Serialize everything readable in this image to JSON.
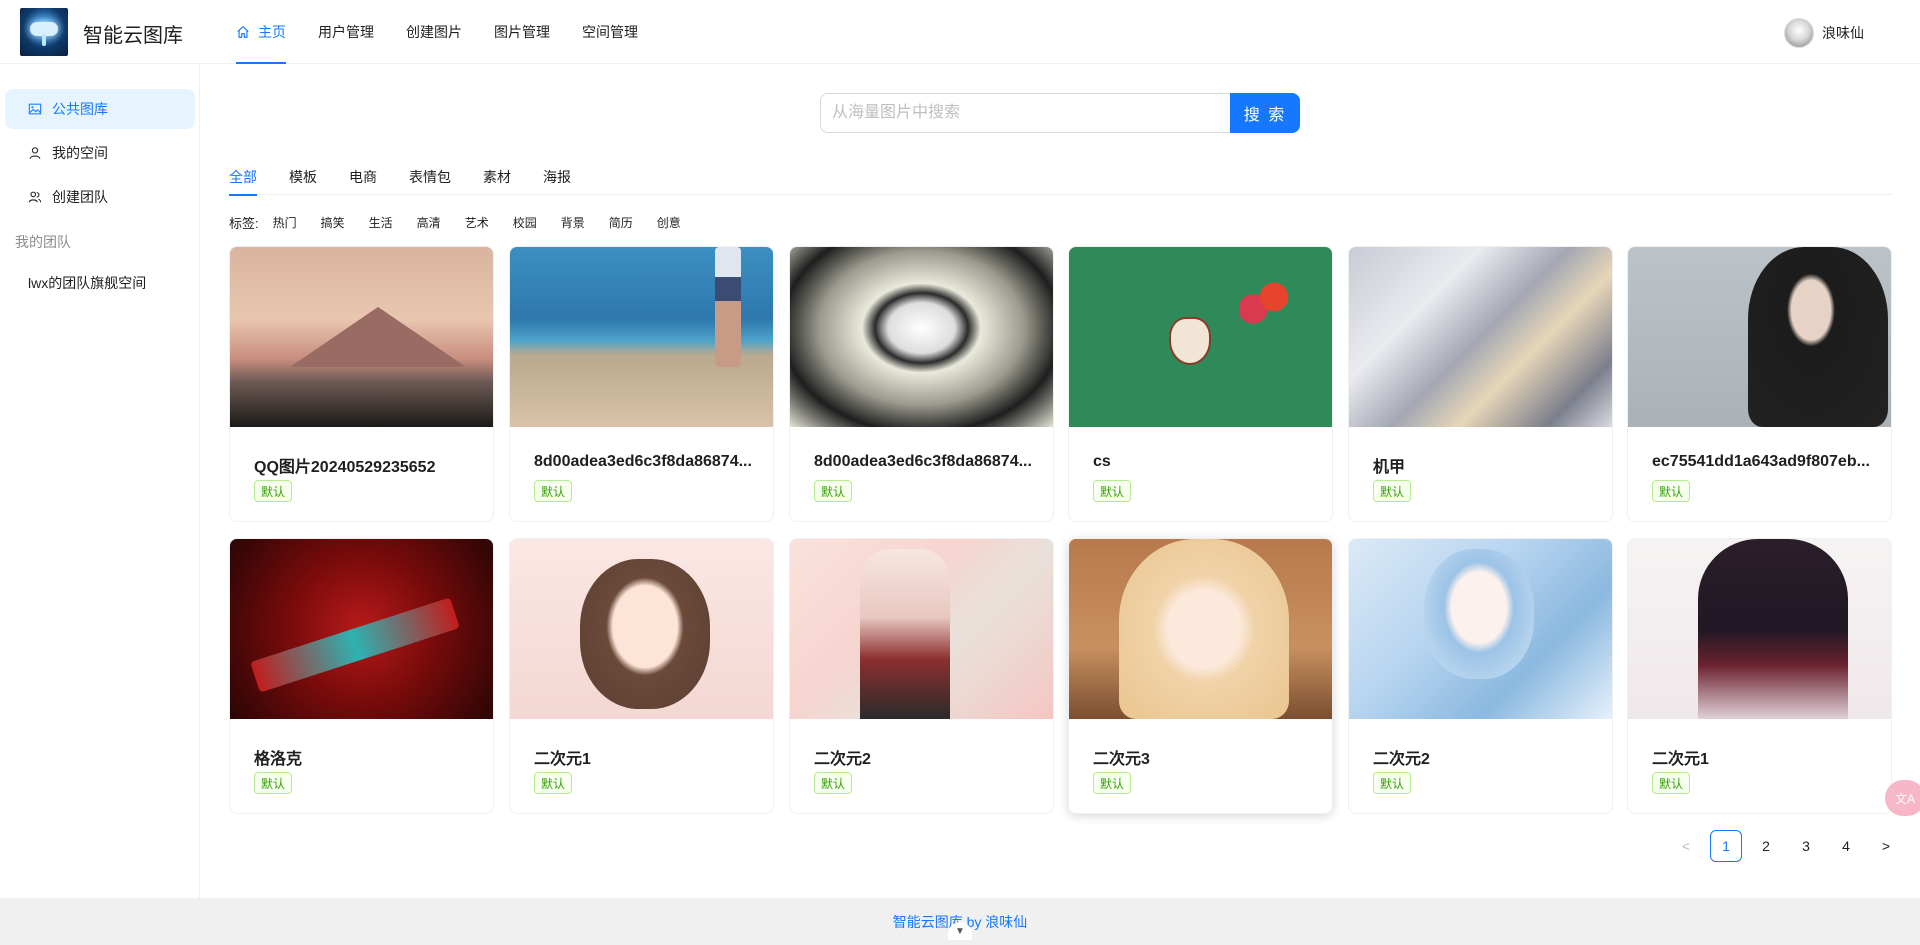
{
  "header": {
    "brand": "智能云图库",
    "nav": [
      "主页",
      "用户管理",
      "创建图片",
      "图片管理",
      "空间管理"
    ],
    "user": "浪味仙"
  },
  "sidebar": {
    "items": [
      "公共图库",
      "我的空间",
      "创建团队"
    ],
    "group_title": "我的团队",
    "teams": [
      "lwx的团队旗舰空间"
    ]
  },
  "search": {
    "placeholder": "从海量图片中搜索",
    "button": "搜 索"
  },
  "categories": [
    "全部",
    "模板",
    "电商",
    "表情包",
    "素材",
    "海报"
  ],
  "tags": {
    "label": "标签:",
    "items": [
      "热门",
      "搞笑",
      "生活",
      "高清",
      "艺术",
      "校园",
      "背景",
      "简历",
      "创意"
    ]
  },
  "cards": [
    {
      "title": "QQ图片20240529235652",
      "badge": "默认"
    },
    {
      "title": "8d00adea3ed6c3f8da86874...",
      "badge": "默认"
    },
    {
      "title": "8d00adea3ed6c3f8da86874...",
      "badge": "默认"
    },
    {
      "title": "cs",
      "badge": "默认"
    },
    {
      "title": "机甲",
      "badge": "默认"
    },
    {
      "title": "ec75541dd1a643ad9f807eb...",
      "badge": "默认"
    },
    {
      "title": "格洛克",
      "badge": "默认"
    },
    {
      "title": "二次元1",
      "badge": "默认"
    },
    {
      "title": "二次元2",
      "badge": "默认"
    },
    {
      "title": "二次元3",
      "badge": "默认"
    },
    {
      "title": "二次元2",
      "badge": "默认"
    },
    {
      "title": "二次元1",
      "badge": "默认"
    }
  ],
  "pagination": {
    "prev": "<",
    "pages": [
      "1",
      "2",
      "3",
      "4"
    ],
    "next": ">",
    "current": "1"
  },
  "footer": {
    "text": "智能云图库 by 浪味仙"
  },
  "colors": {
    "accent": "#1677ff",
    "tag_green": "#389e0d"
  }
}
